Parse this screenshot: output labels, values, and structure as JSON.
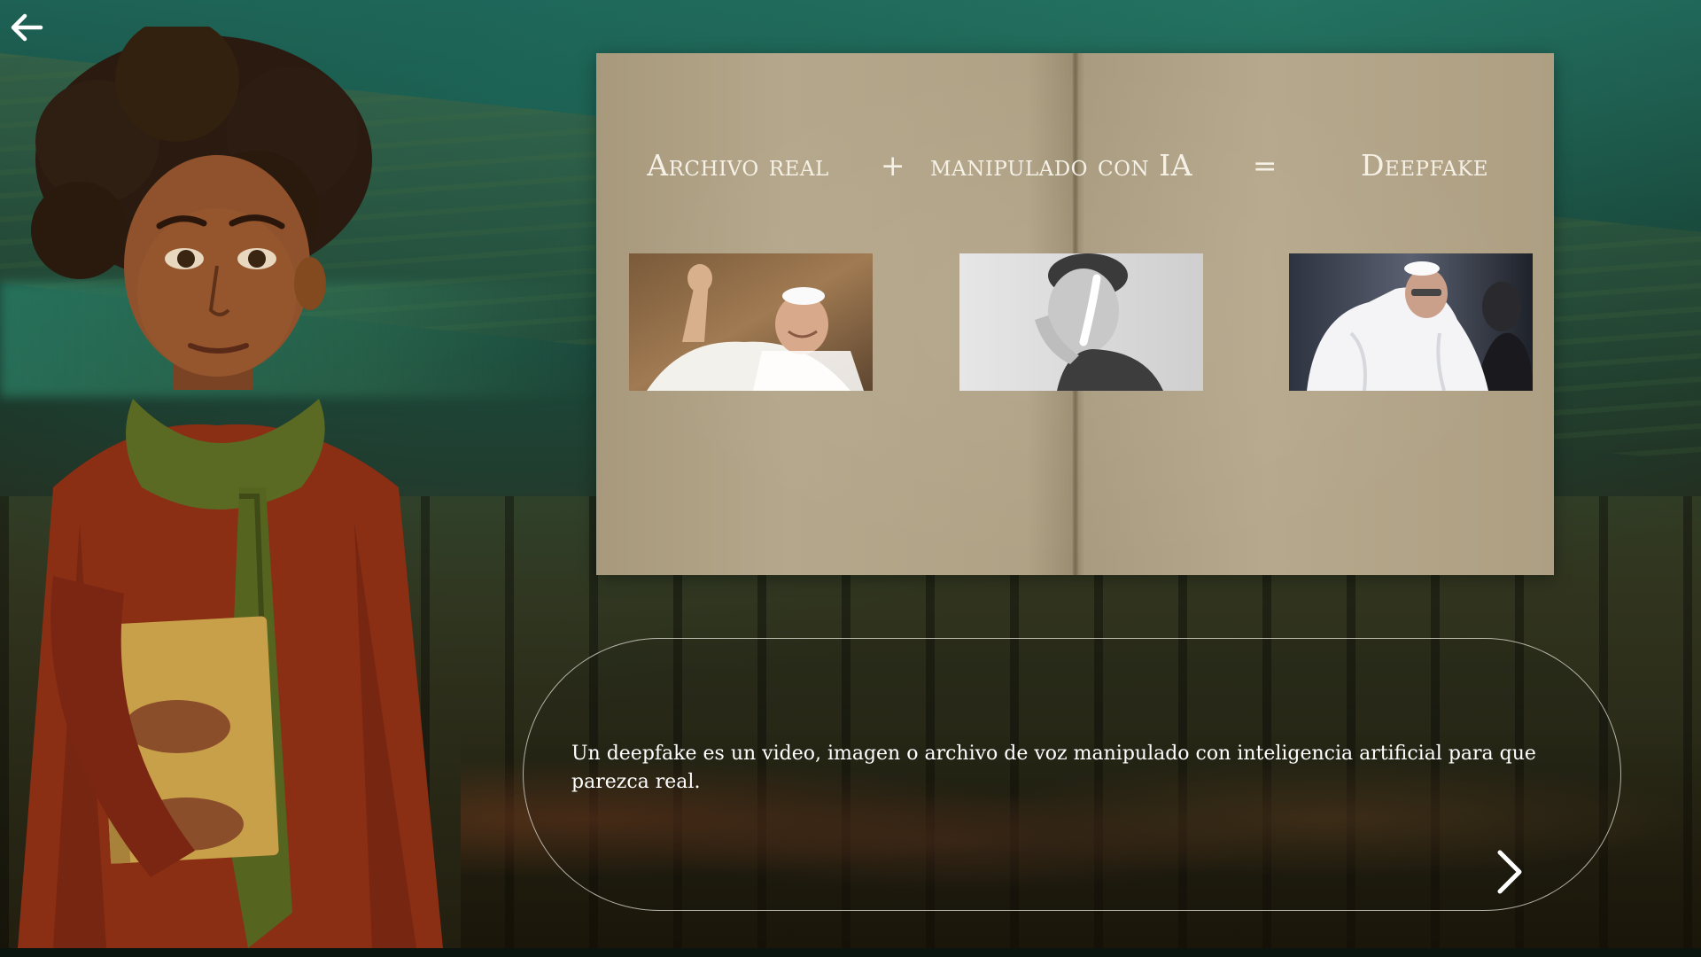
{
  "navigation": {
    "back_icon": "arrow-left-icon",
    "next_icon": "chevron-right-icon"
  },
  "book": {
    "equation": {
      "term_1": "Archivo real",
      "operator_plus": "+",
      "term_2": "manipulado con IA",
      "operator_equals": "=",
      "term_3": "Deepfake"
    },
    "photos": [
      {
        "subject": "pope-waving-real-photo"
      },
      {
        "subject": "man-portrait-ai-manipulation"
      },
      {
        "subject": "pope-white-puffer-jacket-deepfake"
      }
    ]
  },
  "dialog": {
    "text": "Un deepfake es un video, imagen o archivo de voz manipulado con inteligencia artificial para que parezca real."
  },
  "colors": {
    "book_paper": "#b0a285",
    "heading_text": "#f6f1e6",
    "dialog_border": "#e1e1d7",
    "background_teal": "#1e5e52"
  }
}
